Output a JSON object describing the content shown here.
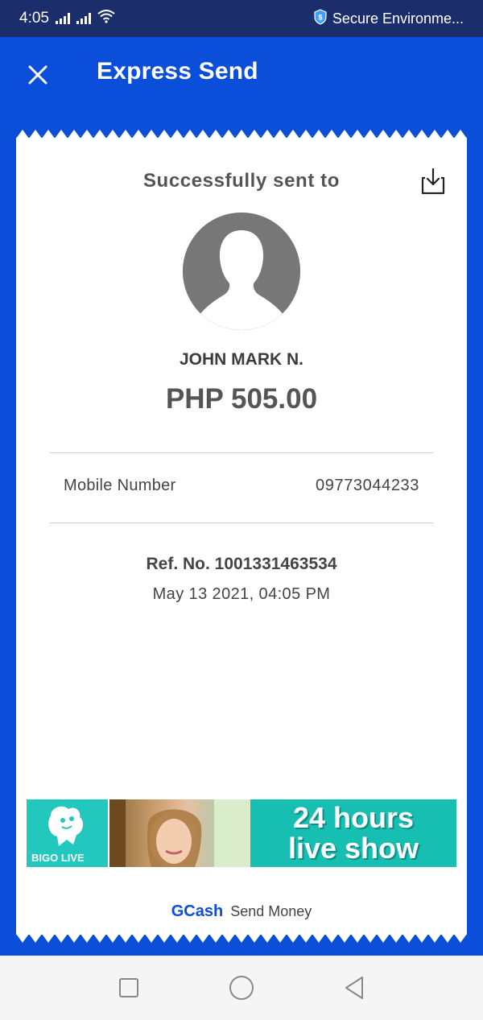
{
  "status_bar": {
    "time": "4:05",
    "secure_text": "Secure Environme..."
  },
  "header": {
    "title": "Express Send"
  },
  "receipt": {
    "success_label": "Successfully sent to",
    "recipient_name": "JOHN MARK N.",
    "amount": "PHP 505.00",
    "mobile_label": "Mobile Number",
    "mobile_value": "09773044233",
    "ref_no": "Ref. No. 1001331463534",
    "date": "May 13 2021, 04:05 PM"
  },
  "ad": {
    "brand": "BIGO LIVE",
    "line1": "24 hours",
    "line2": "live show"
  },
  "footer": {
    "brand": "GCash",
    "text": "Send Money"
  },
  "colors": {
    "primary_blue": "#0a4ed9",
    "status_bar": "#1b2e6b",
    "ad_teal": "#18c2b0"
  },
  "icons": {
    "close": "close-icon",
    "download": "download-icon",
    "avatar": "user-silhouette",
    "shield": "shield-icon",
    "wifi": "wifi-icon",
    "signal": "signal-icon",
    "nav_recent": "square-icon",
    "nav_home": "circle-icon",
    "nav_back": "triangle-back-icon"
  }
}
